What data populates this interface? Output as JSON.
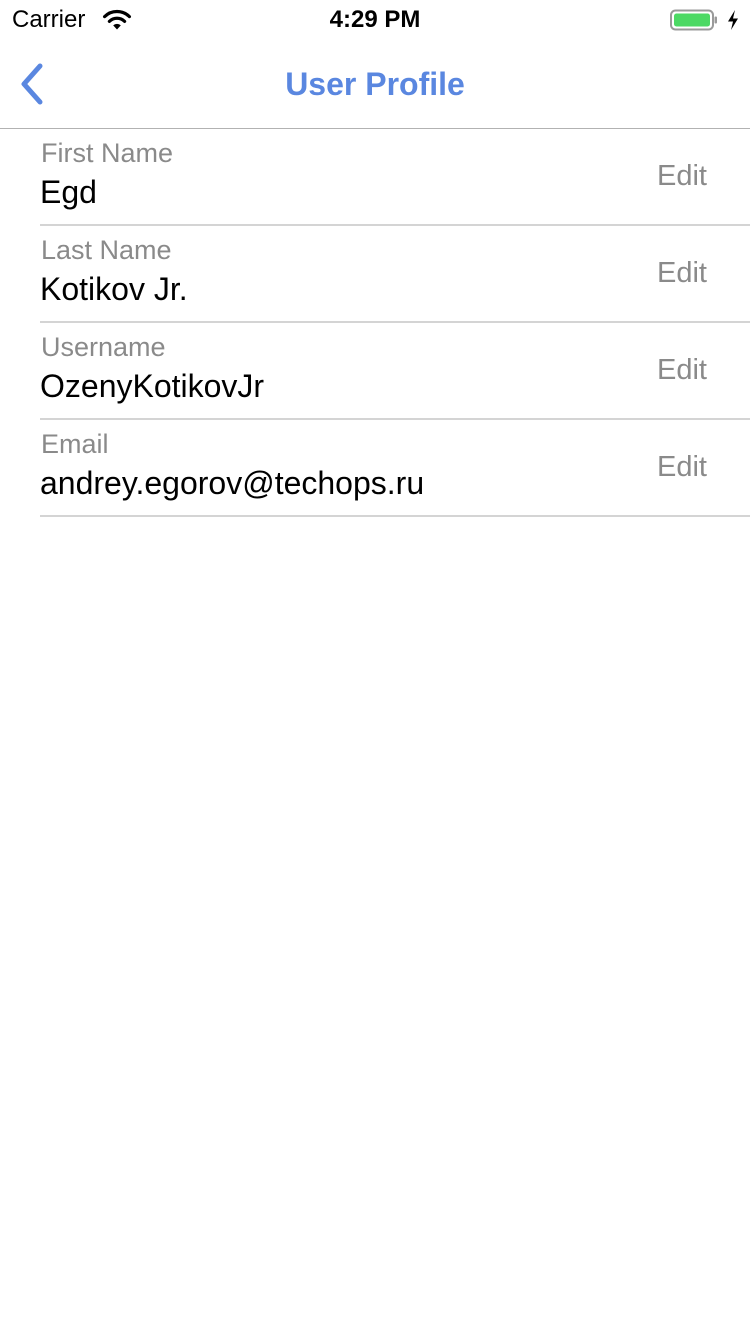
{
  "status_bar": {
    "carrier": "Carrier",
    "time": "4:29 PM",
    "wifi_icon": "wifi-icon",
    "battery_icon": "battery-icon",
    "battery_color": "#4cd964",
    "charging_icon": "bolt-icon"
  },
  "nav": {
    "back_icon": "chevron-left-icon",
    "title": "User Profile",
    "accent_color": "#5a87e0"
  },
  "profile": {
    "fields": [
      {
        "label": "First Name",
        "value": "Egd",
        "action": "Edit"
      },
      {
        "label": "Last Name",
        "value": "Kotikov Jr.",
        "action": "Edit"
      },
      {
        "label": "Username",
        "value": "OzenyKotikovJr",
        "action": "Edit"
      },
      {
        "label": "Email",
        "value": "andrey.egorov@techops.ru",
        "action": "Edit"
      }
    ]
  }
}
